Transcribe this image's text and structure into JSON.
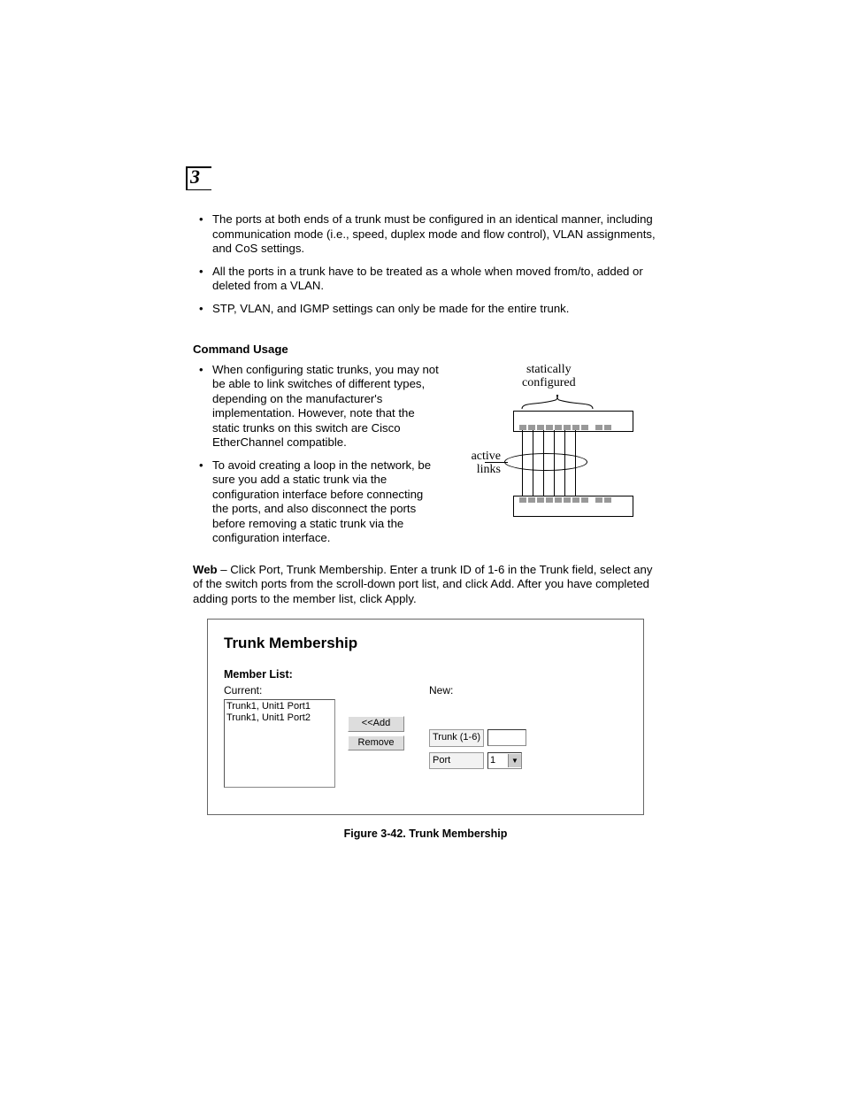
{
  "chapter_number": "3",
  "intro_bullets": [
    "The ports at both ends of a trunk must be configured in an identical manner, including communication mode (i.e., speed, duplex mode and flow control), VLAN assignments, and CoS settings.",
    "All the ports in a trunk have to be treated as a whole when moved from/to, added or deleted from a VLAN.",
    "STP, VLAN, and IGMP settings can only be made for the entire trunk."
  ],
  "section_heading": "Command Usage",
  "usage_bullets": [
    "When configuring static trunks, you may not be able to link switches of different types, depending on the manufacturer's implementation. However, note that the static trunks on this switch are Cisco EtherChannel compatible.",
    "To avoid creating a loop in the network, be sure you add a static trunk via the configuration interface before connecting the ports, and also disconnect the ports before removing a static trunk via the configuration interface."
  ],
  "diagram": {
    "static_label_line1": "statically",
    "static_label_line2": "configured",
    "active_label_line1": "active",
    "active_label_line2": "links"
  },
  "web_para_lead": "Web",
  "web_para_rest": " – Click Port, Trunk Membership. Enter a trunk ID of 1-6 in the Trunk field, select any of the switch ports from the scroll-down port list, and click Add. After you have completed adding ports to the member list, click Apply.",
  "screenshot": {
    "title": "Trunk Membership",
    "member_list_label": "Member List:",
    "current_label": "Current:",
    "new_label": "New:",
    "list_items": [
      "Trunk1, Unit1 Port1",
      "Trunk1, Unit1 Port2"
    ],
    "add_btn": "<<Add",
    "remove_btn": "Remove",
    "trunk_label": "Trunk (1-6)",
    "port_label": "Port",
    "port_value": "1"
  },
  "figure_caption": "Figure 3-42.  Trunk Membership"
}
